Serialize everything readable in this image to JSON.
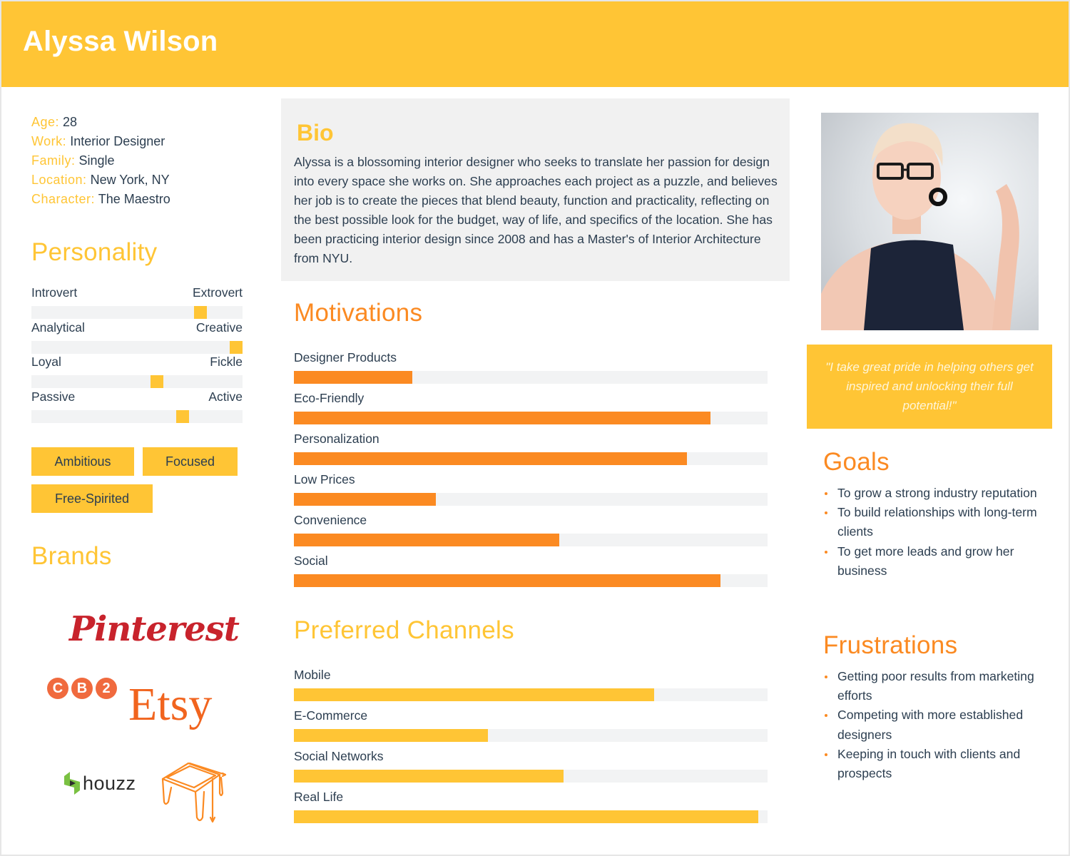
{
  "persona": {
    "name": "Alyssa Wilson"
  },
  "facts": [
    {
      "key": "Age:",
      "value": "28"
    },
    {
      "key": "Work:",
      "value": "Interior Designer"
    },
    {
      "key": "Family:",
      "value": "Single"
    },
    {
      "key": "Location:",
      "value": "New York, NY"
    },
    {
      "key": "Character:",
      "value": "The Maestro"
    }
  ],
  "personality": {
    "title": "Personality",
    "scales": [
      {
        "left": "Introvert",
        "right": "Extrovert",
        "value": 0.82
      },
      {
        "left": "Analytical",
        "right": "Creative",
        "value": 1.0
      },
      {
        "left": "Loyal",
        "right": "Fickle",
        "value": 0.6
      },
      {
        "left": "Passive",
        "right": "Active",
        "value": 0.73
      }
    ],
    "accent_color": "#ffc535"
  },
  "traits": [
    "Ambitious",
    "Focused",
    "Free-Spirited"
  ],
  "brands": {
    "title": "Brands",
    "logos": [
      {
        "name": "Pinterest",
        "text": "Pinterest",
        "color": "#c8232c"
      },
      {
        "name": "CB2",
        "letters": [
          "C",
          "B",
          "2"
        ],
        "color": "#f06a3e"
      },
      {
        "name": "Etsy",
        "text": "Etsy",
        "color": "#f1641e"
      },
      {
        "name": "houzz",
        "text": "houzz",
        "color": "#7ac142"
      },
      {
        "name": "stool-brand",
        "icon": "stool-icon",
        "color": "#fb8a22"
      }
    ]
  },
  "bio": {
    "title": "Bio",
    "text": "Alyssa is a blossoming interior designer who seeks to translate her passion for design into every space she works on. She approaches each project as a puzzle, and believes her job is to create the pieces that blend beauty, function and practicality, reflecting on the best possible look for the budget, way of life, and specifics of the location. She has been practicing interior design since 2008 and has a Master's of Interior Architecture from NYU."
  },
  "motivations": {
    "title": "Motivations",
    "color": "#fb8a22",
    "items": [
      {
        "label": "Designer Products",
        "value": 0.25
      },
      {
        "label": "Eco-Friendly",
        "value": 0.88
      },
      {
        "label": "Personalization",
        "value": 0.83
      },
      {
        "label": "Low Prices",
        "value": 0.3
      },
      {
        "label": "Convenience",
        "value": 0.56
      },
      {
        "label": "Social",
        "value": 0.9
      }
    ]
  },
  "channels": {
    "title": "Preferred Channels",
    "color": "#ffc535",
    "items": [
      {
        "label": "Mobile",
        "value": 0.76
      },
      {
        "label": "E-Commerce",
        "value": 0.41
      },
      {
        "label": "Social Networks",
        "value": 0.57
      },
      {
        "label": "Real Life",
        "value": 0.98
      }
    ]
  },
  "quote": "\"I take great pride in helping others get inspired and unlocking their full potential!\"",
  "goals": {
    "title": "Goals",
    "items": [
      "To grow a strong industry reputation",
      "To build relationships with long-term clients",
      "To get more leads and grow her business"
    ]
  },
  "frustrations": {
    "title": "Frustrations",
    "items": [
      "Getting poor results from marketing efforts",
      "Competing with more established designers",
      "Keeping in touch with clients and prospects"
    ]
  }
}
